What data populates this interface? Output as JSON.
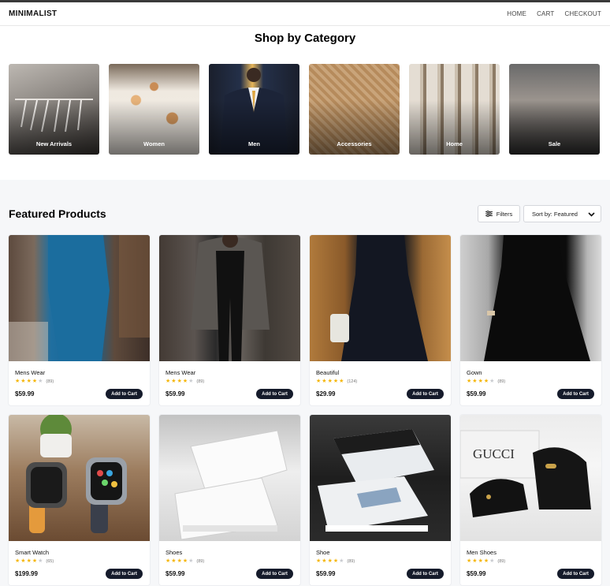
{
  "nav": {
    "brand": "MINIMALIST",
    "links": [
      "HOME",
      "CART",
      "CHECKOUT"
    ]
  },
  "categories": {
    "title": "Shop by Category",
    "items": [
      {
        "label": "New Arrivals"
      },
      {
        "label": "Women"
      },
      {
        "label": "Men"
      },
      {
        "label": "Accessories"
      },
      {
        "label": "Home"
      },
      {
        "label": "Sale"
      }
    ]
  },
  "featured": {
    "title": "Featured Products",
    "filters_label": "Filters",
    "sort_label": "Sort by: Featured",
    "add_to_cart_label": "Add to Cart",
    "products": [
      {
        "name": "Mens Wear",
        "rating": 4,
        "reviews": "(89)",
        "price": "$59.99"
      },
      {
        "name": "Mens Wear",
        "rating": 4,
        "reviews": "(89)",
        "price": "$59.99"
      },
      {
        "name": "Beautiful",
        "rating": 4,
        "reviews": "(124)",
        "price": "$29.99"
      },
      {
        "name": "Gown",
        "rating": 4,
        "reviews": "(89)",
        "price": "$59.99"
      },
      {
        "name": "Smart Watch",
        "rating": 4,
        "reviews": "(65)",
        "price": "$199.99"
      },
      {
        "name": "Shoes",
        "rating": 4,
        "reviews": "(89)",
        "price": "$59.99"
      },
      {
        "name": "Shoe",
        "rating": 4,
        "reviews": "(89)",
        "price": "$59.99"
      },
      {
        "name": "Men Shoes",
        "rating": 4,
        "reviews": "(89)",
        "price": "$59.99"
      }
    ]
  },
  "colors": {
    "accent": "#151b2b",
    "star": "#f5b60a",
    "section_bg": "#f6f7f9"
  },
  "image_text": {
    "gucci_box": "GUCCI"
  }
}
